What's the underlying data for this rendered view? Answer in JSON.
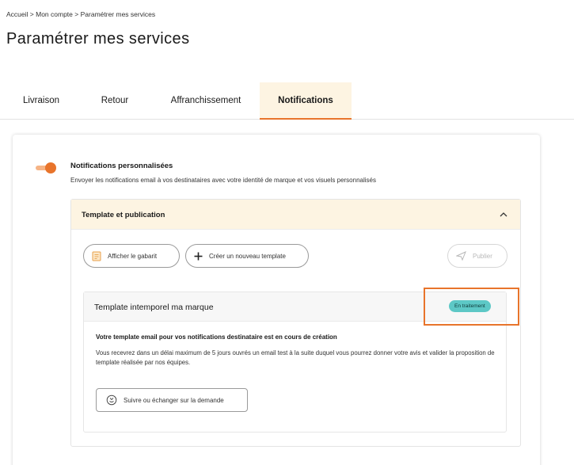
{
  "breadcrumb": {
    "item1": "Accueil",
    "sep1": ">",
    "item2": "Mon compte",
    "sep2": ">",
    "item3": "Paramétrer mes services"
  },
  "page": {
    "title": "Paramétrer mes services"
  },
  "tabs": [
    {
      "label": "Livraison",
      "active": false
    },
    {
      "label": "Retour",
      "active": false
    },
    {
      "label": "Affranchissement",
      "active": false
    },
    {
      "label": "Notifications",
      "active": true
    }
  ],
  "notifications": {
    "toggle_on": true,
    "title": "Notifications personnalisées",
    "description": "Envoyer les notifications email à vos destinataires avec votre identité de marque et vos visuels personnalisés"
  },
  "template_section": {
    "title": "Template et publication",
    "expanded": true,
    "buttons": {
      "view_template": "Afficher le gabarit",
      "create_template": "Créer un nouveau template",
      "publish": "Publier"
    }
  },
  "template_card": {
    "title": "Template intemporel ma marque",
    "status": "En traitement",
    "message_title": "Votre template email pour vos notifications destinataire est en cours de création",
    "message_body": "Vous recevrez dans un délai maximum de 5 jours ouvrés un email test à la suite duquel vous pourrez donner votre avis et valider la proposition de template réalisée par nos équipes.",
    "follow_button": "Suivre ou échanger sur la demande"
  },
  "colors": {
    "accent": "#e8742b",
    "tab_active_bg": "#fdf4e2",
    "status_badge": "#5dc8c6"
  },
  "icons": {
    "view_template": "document-icon",
    "create_template": "plus-icon",
    "publish": "send-icon",
    "collapse": "chevron-up-icon",
    "follow": "chat-icon"
  }
}
